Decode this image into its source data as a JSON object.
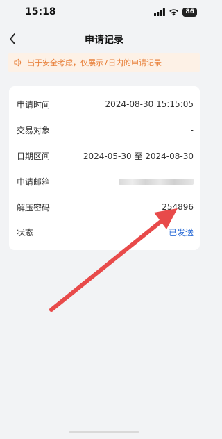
{
  "status_bar": {
    "time": "15:18",
    "battery": "86"
  },
  "nav": {
    "title": "申请记录"
  },
  "notice": {
    "text": "出于安全考虑，仅展示7日内的申请记录",
    "color": "#e8803a"
  },
  "record": {
    "rows": [
      {
        "label": "申请时间",
        "value": "2024-08-30 15:15:05"
      },
      {
        "label": "交易对象",
        "value": "-"
      },
      {
        "label": "日期区间",
        "value": "2024-05-30 至 2024-08-30"
      },
      {
        "label": "申请邮箱",
        "value": ""
      },
      {
        "label": "解压密码",
        "value": "254896"
      },
      {
        "label": "状态",
        "value": "已发送"
      }
    ]
  },
  "colors": {
    "accent": "#2f6fd8",
    "annotation_arrow": "#e84a4a"
  }
}
